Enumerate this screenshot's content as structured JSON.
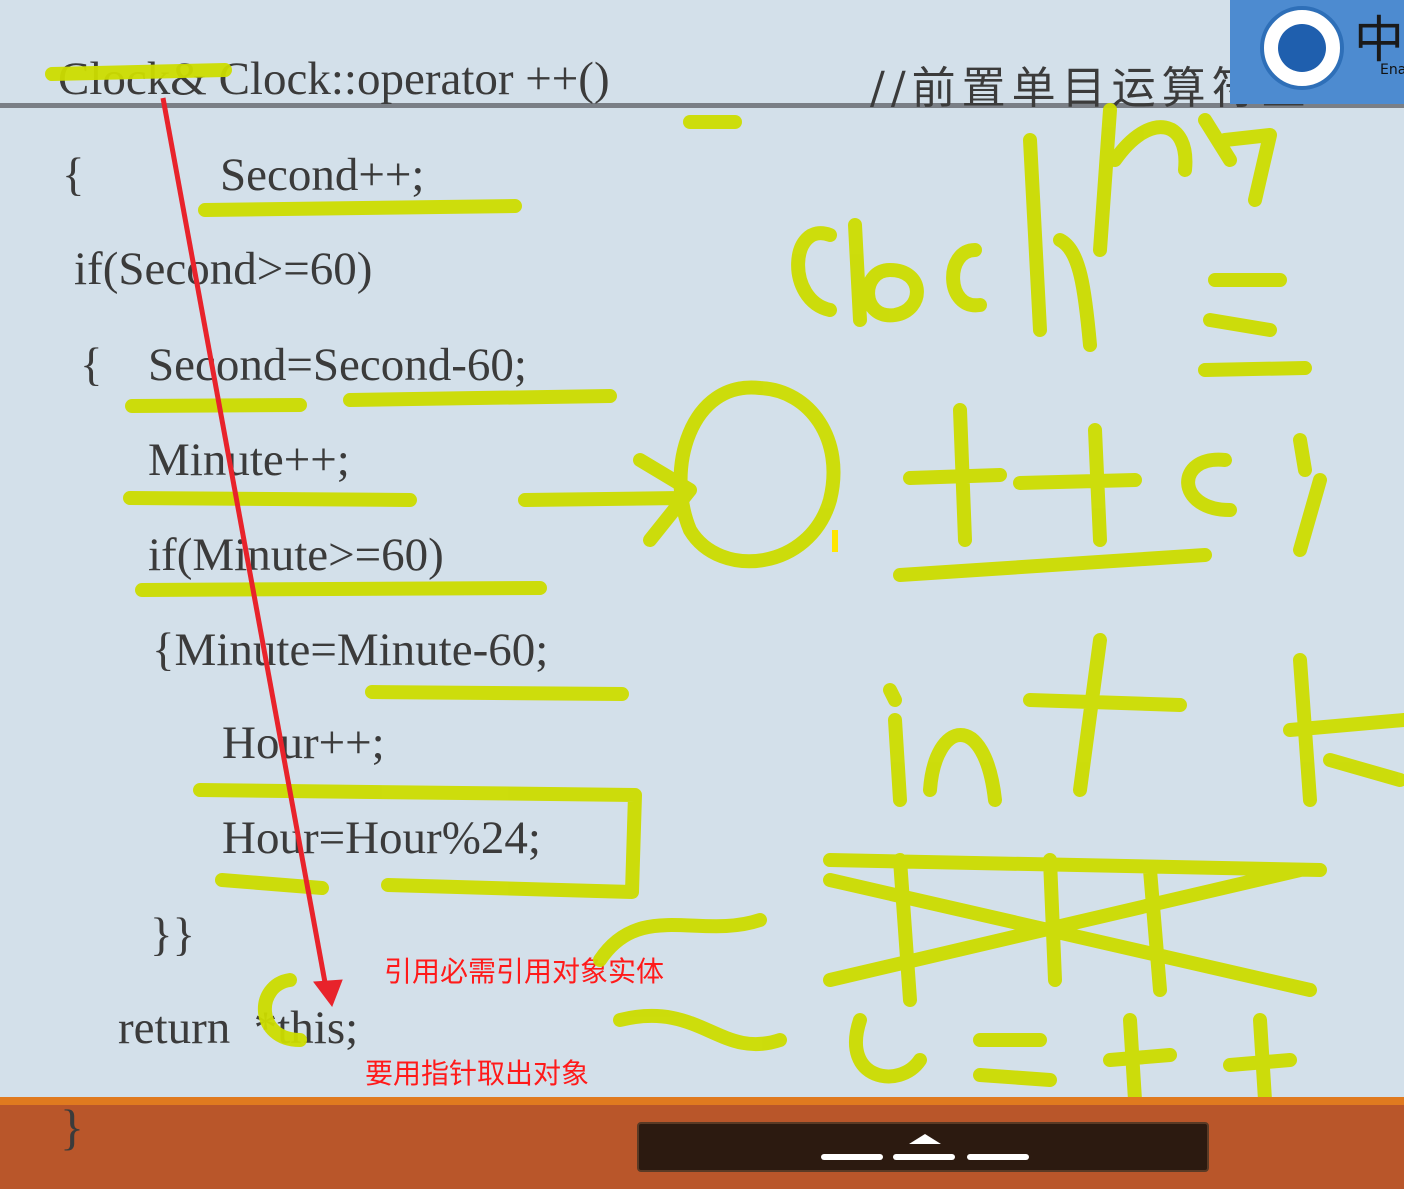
{
  "slide": {
    "header_code": "Clock& Clock::operator ++()",
    "header_comment": "//前置单目运算符重",
    "code_lines": [
      "{",
      "Second++;",
      "if(Second>=60)",
      "{",
      "Second=Second-60;",
      "Minute++;",
      "if(Minute>=60)",
      "{Minute=Minute-60;",
      "Hour++;",
      "Hour=Hour%24;",
      "}}",
      "return  *this;",
      "}"
    ],
    "annotation_1": "引用必需引用对象实体",
    "annotation_2": "要用指针取出对象"
  },
  "logo": {
    "glyph": "中",
    "sub": "Ena"
  },
  "ink": {
    "highlight_color": "#ccdc00",
    "arrow_color": "#e8232b",
    "handwriting": [
      "Clock",
      "++c;",
      "int"
    ]
  },
  "controls": {
    "icon_names": [
      "dash-icon",
      "caret-up-icon",
      "dash-icon",
      "dash-icon"
    ]
  }
}
